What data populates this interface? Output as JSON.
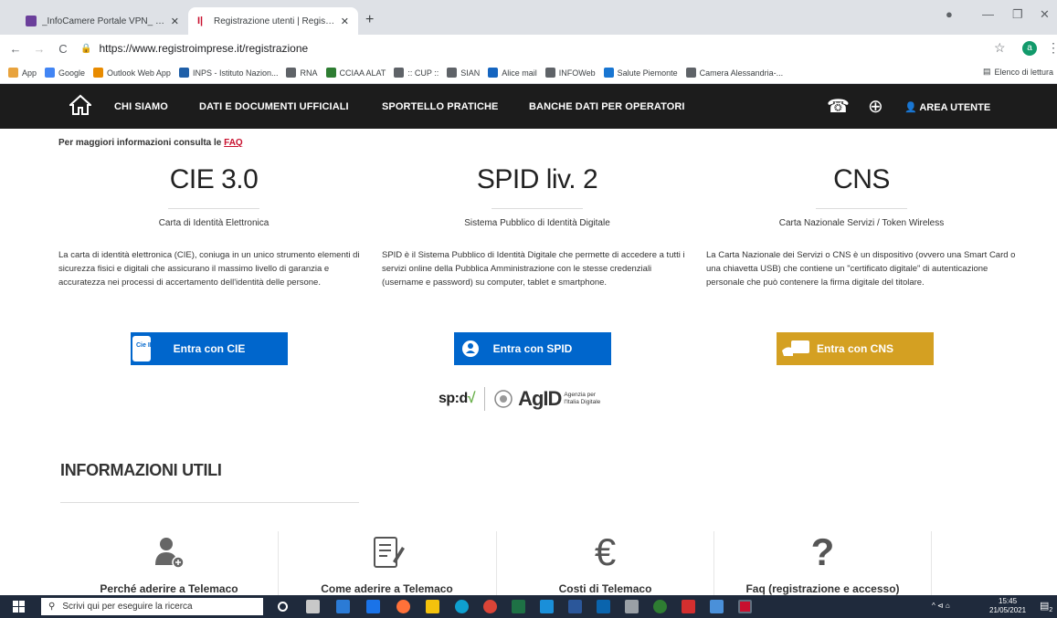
{
  "browser": {
    "tabs": [
      {
        "title": "_InfoCamere Portale VPN_ - Principa"
      },
      {
        "title": "Registrazione utenti | Registro Impre"
      }
    ],
    "url": "https://www.registroimprese.it/registrazione",
    "profile_initial": "a",
    "bookmarks": [
      {
        "label": "App",
        "color": "#e8a33d"
      },
      {
        "label": "Google",
        "color": "#4285f4"
      },
      {
        "label": "Outlook Web App",
        "color": "#e88b00"
      },
      {
        "label": "INPS - Istituto Nazion...",
        "color": "#1f5fa8"
      },
      {
        "label": "RNA",
        "color": "#5f6368"
      },
      {
        "label": "CCIAA ALAT",
        "color": "#2e7d32"
      },
      {
        "label": ":: CUP ::",
        "color": "#5f6368"
      },
      {
        "label": "SIAN",
        "color": "#5f6368"
      },
      {
        "label": "Alice mail",
        "color": "#1565c0"
      },
      {
        "label": "INFOWeb",
        "color": "#5f6368"
      },
      {
        "label": "Salute Piemonte",
        "color": "#1976d2"
      },
      {
        "label": "Camera Alessandria-...",
        "color": "#5f6368"
      }
    ],
    "reading_list": "Elenco di lettura"
  },
  "nav": {
    "items": [
      "CHI SIAMO",
      "DATI E DOCUMENTI UFFICIALI",
      "SPORTELLO PRATICHE",
      "BANCHE DATI PER OPERATORI"
    ],
    "area_utente": "AREA UTENTE"
  },
  "faq": {
    "prefix": "Per maggiori informazioni consulta le ",
    "link": "FAQ"
  },
  "columns": [
    {
      "title": "CIE 3.0",
      "subtitle": "Carta di Identità Elettronica",
      "description": "La carta di identità elettronica (CIE), coniuga in un unico strumento elementi di sicurezza fisici e digitali che assicurano il massimo livello di garanzia e accuratezza nei processi di accertamento dell'identità delle persone.",
      "button": "Entra con CIE"
    },
    {
      "title": "SPID liv. 2",
      "subtitle": "Sistema Pubblico di Identità Digitale",
      "description": "SPID è il Sistema Pubblico di Identità Digitale che permette di accedere a tutti i servizi online della Pubblica Amministrazione con le stesse credenziali (username e password) su computer, tablet e smartphone.",
      "button": "Entra con SPID"
    },
    {
      "title": "CNS",
      "subtitle": "Carta Nazionale Servizi / Token Wireless",
      "description": "La Carta Nazionale dei Servizi o CNS è un dispositivo (ovvero una Smart Card o una chiavetta USB) che contiene un \"certificato digitale\" di autenticazione personale che può contenere la firma digitale del titolare.",
      "button": "Entra con CNS"
    }
  ],
  "logos": {
    "spid": "sp:d",
    "agid": "AgID",
    "agid_sub_1": "Agenzia per",
    "agid_sub_2": "l'Italia Digitale",
    "cie_badge": "Cie ID"
  },
  "info": {
    "heading": "INFORMAZIONI UTILI",
    "cards": [
      "Perché aderire a Telemaco",
      "Come aderire a Telemaco",
      "Costi di Telemaco",
      "Faq (registrazione e accesso)"
    ]
  },
  "taskbar": {
    "search_placeholder": "Scrivi qui per eseguire la ricerca",
    "time": "15:45",
    "date": "21/05/2021",
    "notification_count": "2"
  }
}
